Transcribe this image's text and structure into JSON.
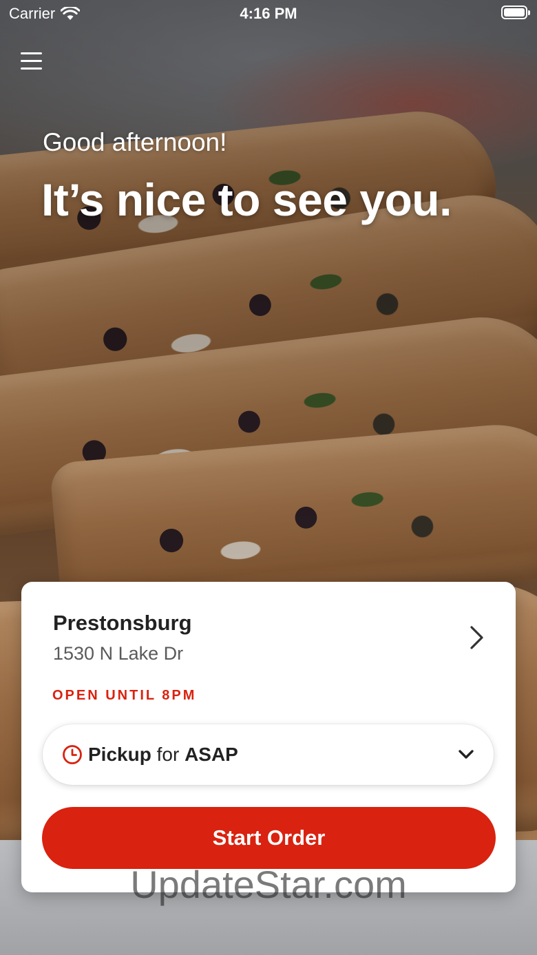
{
  "status_bar": {
    "carrier": "Carrier",
    "time": "4:16 PM",
    "wifi_icon": "wifi-icon",
    "battery_icon": "battery-icon"
  },
  "header": {
    "menu_icon": "hamburger-menu-icon"
  },
  "hero": {
    "greeting": "Good afternoon!",
    "headline": "It’s nice to see you.",
    "image": "quesadilla-photo"
  },
  "location_card": {
    "name": "Prestonsburg",
    "address": "1530 N Lake Dr",
    "hours_status": "OPEN UNTIL 8PM",
    "chevron_icon": "chevron-right-icon",
    "order_mode": {
      "icon": "clock-icon",
      "mode": "Pickup",
      "connector": "for",
      "time": "ASAP",
      "dropdown_icon": "chevron-down-icon"
    },
    "start_order_label": "Start Order"
  },
  "watermark": "UpdateStar.com",
  "colors": {
    "accent": "#d9220f",
    "card_background": "#ffffff",
    "text_primary": "#222222",
    "text_secondary": "#5a5a5a"
  }
}
